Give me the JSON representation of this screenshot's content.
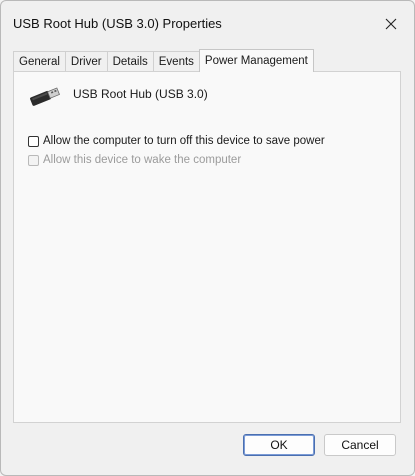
{
  "window": {
    "title": "USB Root Hub (USB 3.0) Properties",
    "close_icon": "close-icon"
  },
  "tabs": [
    {
      "label": "General",
      "active": false
    },
    {
      "label": "Driver",
      "active": false
    },
    {
      "label": "Details",
      "active": false
    },
    {
      "label": "Events",
      "active": false
    },
    {
      "label": "Power Management",
      "active": true
    }
  ],
  "device": {
    "icon": "usb-connector-icon",
    "name": "USB Root Hub (USB 3.0)"
  },
  "options": [
    {
      "label": "Allow the computer to turn off this device to save power",
      "checked": false,
      "enabled": true
    },
    {
      "label": "Allow this device to wake the computer",
      "checked": false,
      "enabled": false
    }
  ],
  "buttons": {
    "ok": "OK",
    "cancel": "Cancel"
  },
  "colors": {
    "window_bg": "#f0f0f0",
    "panel_bg": "#f9f9f9",
    "disabled_text": "#9b9b9b",
    "default_button_border": "#4a6fb0"
  }
}
